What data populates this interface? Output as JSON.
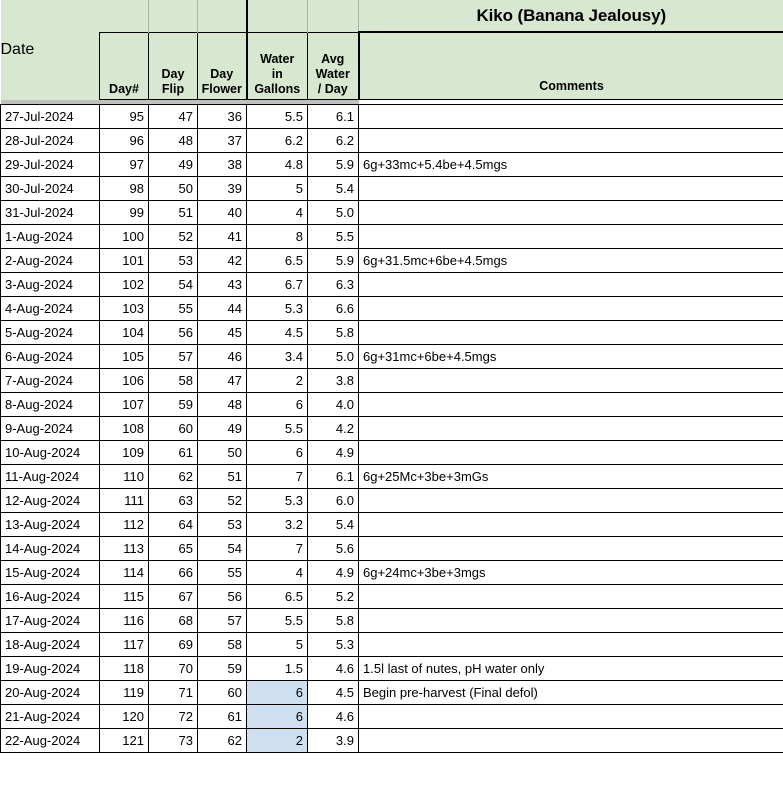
{
  "sheet": {
    "title": "Kiko (Banana Jealousy)",
    "colors": {
      "header_green": "#d8e7cf",
      "avg_column_gray": "#efefef",
      "highlight_blue": "#cfe0f1",
      "separator_gray": "#c0c0c0",
      "grid_line": "#000000"
    }
  },
  "columns": [
    {
      "key": "date",
      "label": "Date",
      "align": "left"
    },
    {
      "key": "day_num",
      "label": "Day#",
      "align": "right"
    },
    {
      "key": "day_flip",
      "label": "Day\nFlip",
      "align": "right"
    },
    {
      "key": "day_flower",
      "label": "Day\nFlower",
      "align": "right"
    },
    {
      "key": "water",
      "label": "Water\nin\nGallons",
      "align": "right"
    },
    {
      "key": "avg_water",
      "label": "Avg\nWater\n/ Day",
      "align": "right"
    },
    {
      "key": "comments",
      "label": "Comments",
      "align": "left"
    }
  ],
  "column_labels": {
    "date": "Date",
    "day_num": "Day#",
    "day_flip_l1": "Day",
    "day_flip_l2": "Flip",
    "day_flower_l1": "Day",
    "day_flower_l2": "Flower",
    "water_l1": "Water",
    "water_l2": "in",
    "water_l3": "Gallons",
    "avg_l1": "Avg",
    "avg_l2": "Water",
    "avg_l3": "/ Day",
    "comments": "Comments"
  },
  "rows": [
    {
      "date": "27-Jul-2024",
      "day_num": "95",
      "day_flip": "47",
      "day_flower": "36",
      "water": "5.5",
      "avg_water": "6.1",
      "comments": "",
      "water_highlight": false
    },
    {
      "date": "28-Jul-2024",
      "day_num": "96",
      "day_flip": "48",
      "day_flower": "37",
      "water": "6.2",
      "avg_water": "6.2",
      "comments": "",
      "water_highlight": false
    },
    {
      "date": "29-Jul-2024",
      "day_num": "97",
      "day_flip": "49",
      "day_flower": "38",
      "water": "4.8",
      "avg_water": "5.9",
      "comments": "6g+33mc+5.4be+4.5mgs",
      "water_highlight": false
    },
    {
      "date": "30-Jul-2024",
      "day_num": "98",
      "day_flip": "50",
      "day_flower": "39",
      "water": "5",
      "avg_water": "5.4",
      "comments": "",
      "water_highlight": false
    },
    {
      "date": "31-Jul-2024",
      "day_num": "99",
      "day_flip": "51",
      "day_flower": "40",
      "water": "4",
      "avg_water": "5.0",
      "comments": "",
      "water_highlight": false
    },
    {
      "date": "1-Aug-2024",
      "day_num": "100",
      "day_flip": "52",
      "day_flower": "41",
      "water": "8",
      "avg_water": "5.5",
      "comments": "",
      "water_highlight": false
    },
    {
      "date": "2-Aug-2024",
      "day_num": "101",
      "day_flip": "53",
      "day_flower": "42",
      "water": "6.5",
      "avg_water": "5.9",
      "comments": "6g+31.5mc+6be+4.5mgs",
      "water_highlight": false
    },
    {
      "date": "3-Aug-2024",
      "day_num": "102",
      "day_flip": "54",
      "day_flower": "43",
      "water": "6.7",
      "avg_water": "6.3",
      "comments": "",
      "water_highlight": false
    },
    {
      "date": "4-Aug-2024",
      "day_num": "103",
      "day_flip": "55",
      "day_flower": "44",
      "water": "5.3",
      "avg_water": "6.6",
      "comments": "",
      "water_highlight": false
    },
    {
      "date": "5-Aug-2024",
      "day_num": "104",
      "day_flip": "56",
      "day_flower": "45",
      "water": "4.5",
      "avg_water": "5.8",
      "comments": "",
      "water_highlight": false
    },
    {
      "date": "6-Aug-2024",
      "day_num": "105",
      "day_flip": "57",
      "day_flower": "46",
      "water": "3.4",
      "avg_water": "5.0",
      "comments": "6g+31mc+6be+4.5mgs",
      "water_highlight": false
    },
    {
      "date": "7-Aug-2024",
      "day_num": "106",
      "day_flip": "58",
      "day_flower": "47",
      "water": "2",
      "avg_water": "3.8",
      "comments": "",
      "water_highlight": false
    },
    {
      "date": "8-Aug-2024",
      "day_num": "107",
      "day_flip": "59",
      "day_flower": "48",
      "water": "6",
      "avg_water": "4.0",
      "comments": "",
      "water_highlight": false
    },
    {
      "date": "9-Aug-2024",
      "day_num": "108",
      "day_flip": "60",
      "day_flower": "49",
      "water": "5.5",
      "avg_water": "4.2",
      "comments": "",
      "water_highlight": false
    },
    {
      "date": "10-Aug-2024",
      "day_num": "109",
      "day_flip": "61",
      "day_flower": "50",
      "water": "6",
      "avg_water": "4.9",
      "comments": "",
      "water_highlight": false
    },
    {
      "date": "11-Aug-2024",
      "day_num": "110",
      "day_flip": "62",
      "day_flower": "51",
      "water": "7",
      "avg_water": "6.1",
      "comments": "6g+25Mc+3be+3mGs",
      "water_highlight": false
    },
    {
      "date": "12-Aug-2024",
      "day_num": "111",
      "day_flip": "63",
      "day_flower": "52",
      "water": "5.3",
      "avg_water": "6.0",
      "comments": "",
      "water_highlight": false
    },
    {
      "date": "13-Aug-2024",
      "day_num": "112",
      "day_flip": "64",
      "day_flower": "53",
      "water": "3.2",
      "avg_water": "5.4",
      "comments": "",
      "water_highlight": false
    },
    {
      "date": "14-Aug-2024",
      "day_num": "113",
      "day_flip": "65",
      "day_flower": "54",
      "water": "7",
      "avg_water": "5.6",
      "comments": "",
      "water_highlight": false
    },
    {
      "date": "15-Aug-2024",
      "day_num": "114",
      "day_flip": "66",
      "day_flower": "55",
      "water": "4",
      "avg_water": "4.9",
      "comments": "6g+24mc+3be+3mgs",
      "water_highlight": false
    },
    {
      "date": "16-Aug-2024",
      "day_num": "115",
      "day_flip": "67",
      "day_flower": "56",
      "water": "6.5",
      "avg_water": "5.2",
      "comments": "",
      "water_highlight": false
    },
    {
      "date": "17-Aug-2024",
      "day_num": "116",
      "day_flip": "68",
      "day_flower": "57",
      "water": "5.5",
      "avg_water": "5.8",
      "comments": "",
      "water_highlight": false
    },
    {
      "date": "18-Aug-2024",
      "day_num": "117",
      "day_flip": "69",
      "day_flower": "58",
      "water": "5",
      "avg_water": "5.3",
      "comments": "",
      "water_highlight": false
    },
    {
      "date": "19-Aug-2024",
      "day_num": "118",
      "day_flip": "70",
      "day_flower": "59",
      "water": "1.5",
      "avg_water": "4.6",
      "comments": "1.5l last of nutes, pH water only",
      "water_highlight": false
    },
    {
      "date": "20-Aug-2024",
      "day_num": "119",
      "day_flip": "71",
      "day_flower": "60",
      "water": "6",
      "avg_water": "4.5",
      "comments": "Begin pre-harvest (Final defol)",
      "water_highlight": true
    },
    {
      "date": "21-Aug-2024",
      "day_num": "120",
      "day_flip": "72",
      "day_flower": "61",
      "water": "6",
      "avg_water": "4.6",
      "comments": "",
      "water_highlight": true
    },
    {
      "date": "22-Aug-2024",
      "day_num": "121",
      "day_flip": "73",
      "day_flower": "62",
      "water": "2",
      "avg_water": "3.9",
      "comments": "",
      "water_highlight": true
    }
  ]
}
